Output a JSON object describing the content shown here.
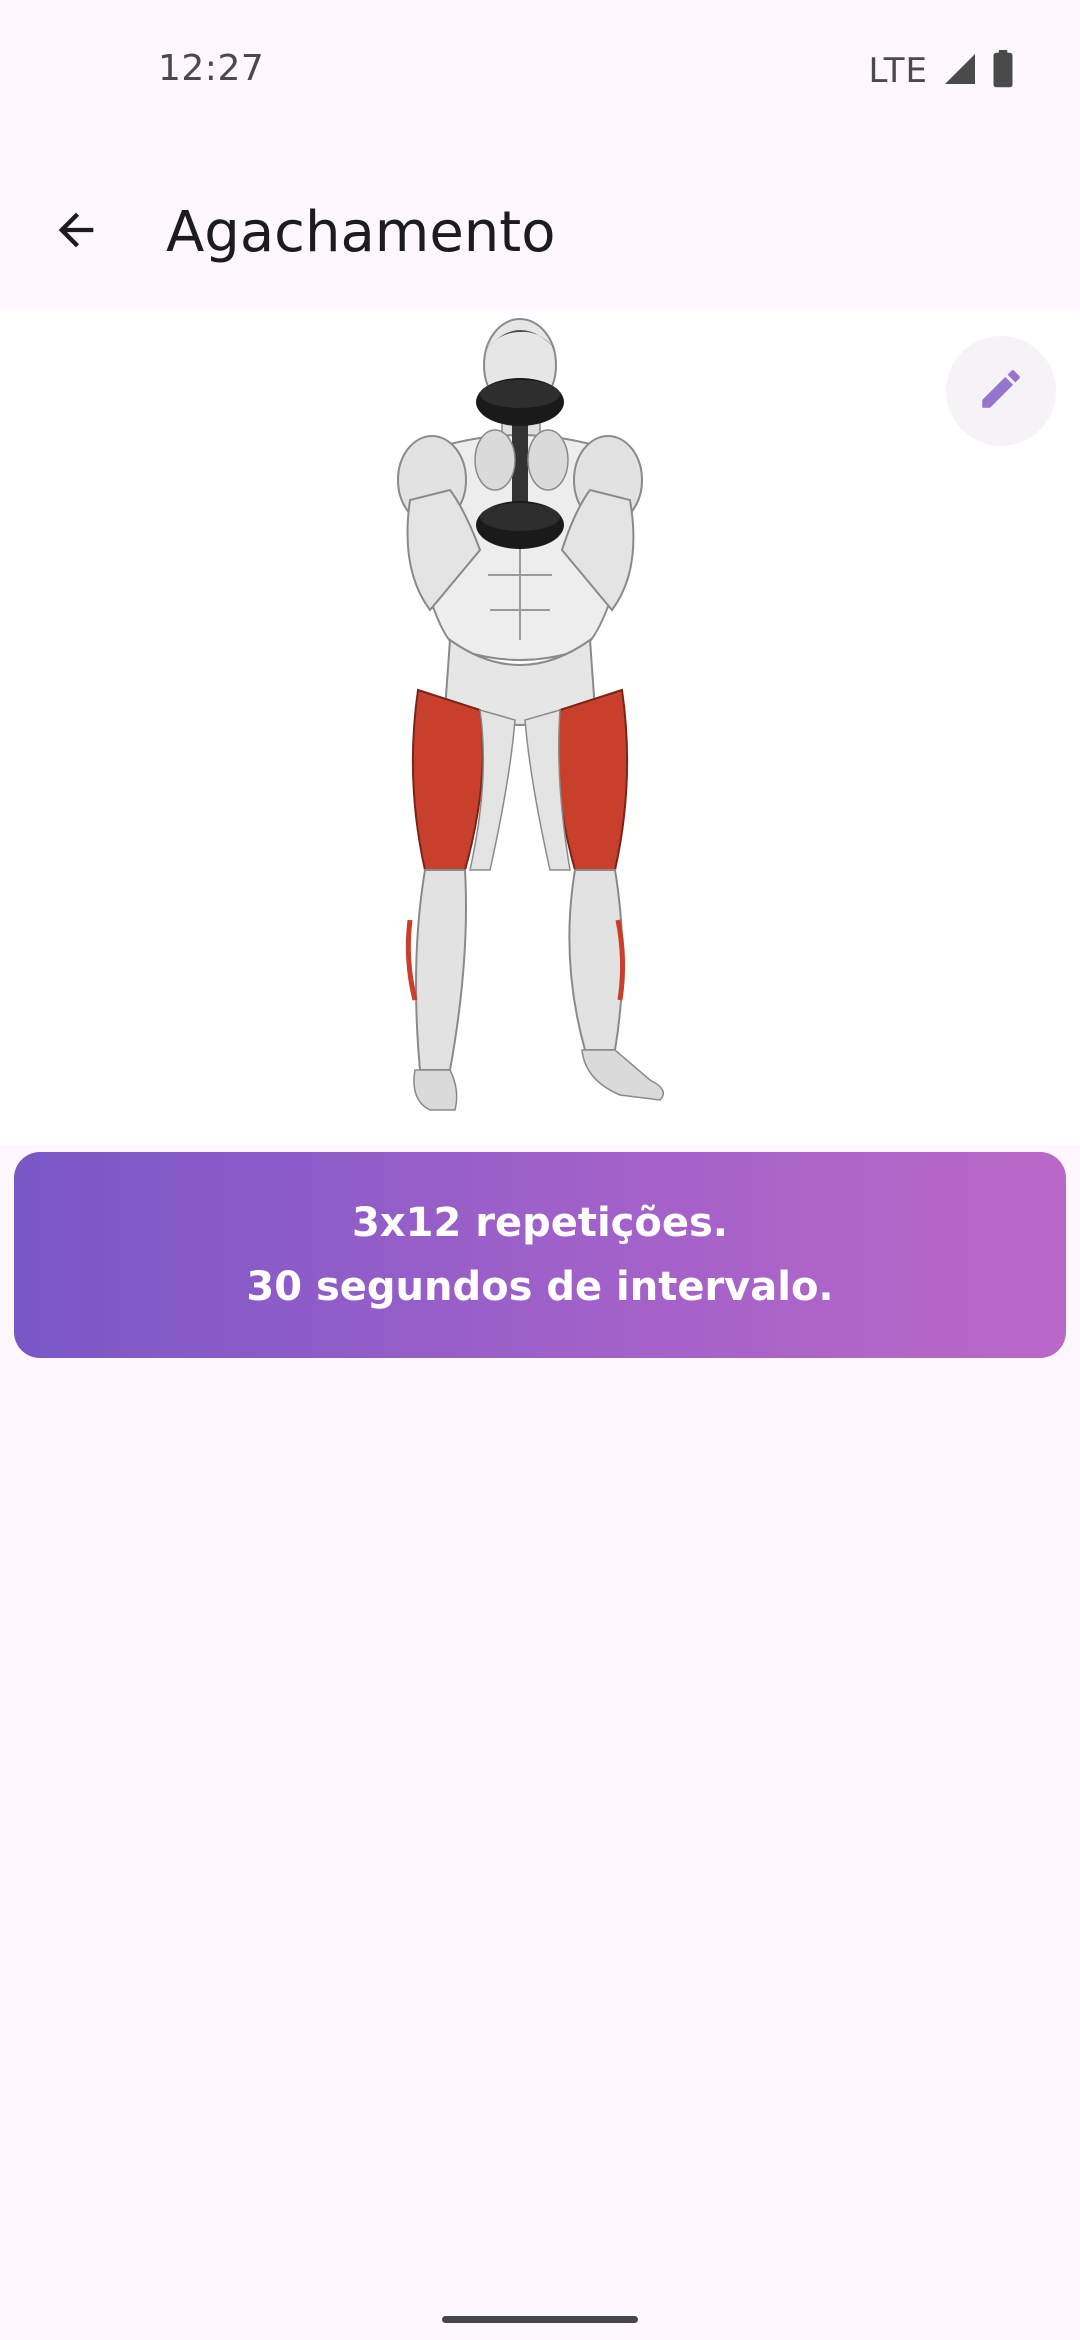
{
  "status_bar": {
    "time": "12:27",
    "network": "LTE",
    "icons": [
      "signal-icon",
      "battery-icon"
    ]
  },
  "app_bar": {
    "back_icon": "arrow-back-icon",
    "title": "Agachamento"
  },
  "exercise": {
    "image": "anatomical-figure-goblet-squat",
    "edit_icon": "pencil-icon",
    "highlight_color": "#C8402C"
  },
  "info_card": {
    "line1": "3x12 repetições.",
    "line2": "30 segundos de intervalo.",
    "gradient_start": "#7A57C6",
    "gradient_end": "#BA68C8"
  },
  "colors": {
    "background": "#FEF7FC",
    "accent": "#9575CD"
  }
}
